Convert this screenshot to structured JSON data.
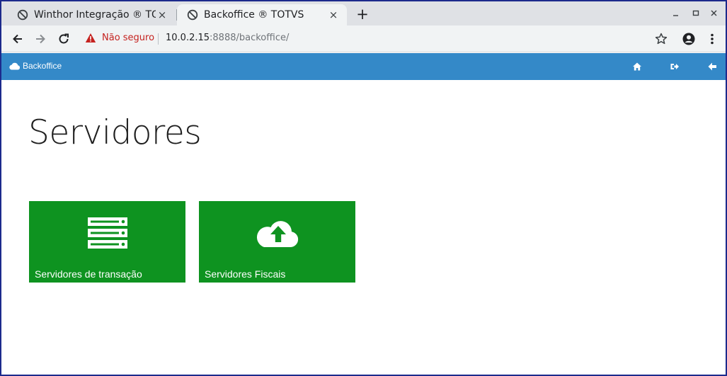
{
  "browser": {
    "tabs": [
      {
        "title": "Winthor Integração ® TO",
        "active": false
      },
      {
        "title": "Backoffice ® TOTVS",
        "active": true
      }
    ],
    "new_tab_label": "+",
    "security_label": "Não seguro",
    "url_host": "10.0.2.15",
    "url_rest": ":8888/backoffice/",
    "close_glyph": "×"
  },
  "appbar": {
    "brand": "Backoffice",
    "icons": [
      "home-icon",
      "logout-icon",
      "back-arrow-icon"
    ]
  },
  "page": {
    "title": "Servidores",
    "tiles": [
      {
        "label": "Servidores de transação",
        "icon": "server-stack-icon"
      },
      {
        "label": "Servidores Fiscais",
        "icon": "cloud-upload-icon"
      }
    ]
  },
  "colors": {
    "appbar": "#3489c8",
    "tile": "#0e9320",
    "warning": "#c5221f",
    "frame": "#1c2a8c"
  }
}
